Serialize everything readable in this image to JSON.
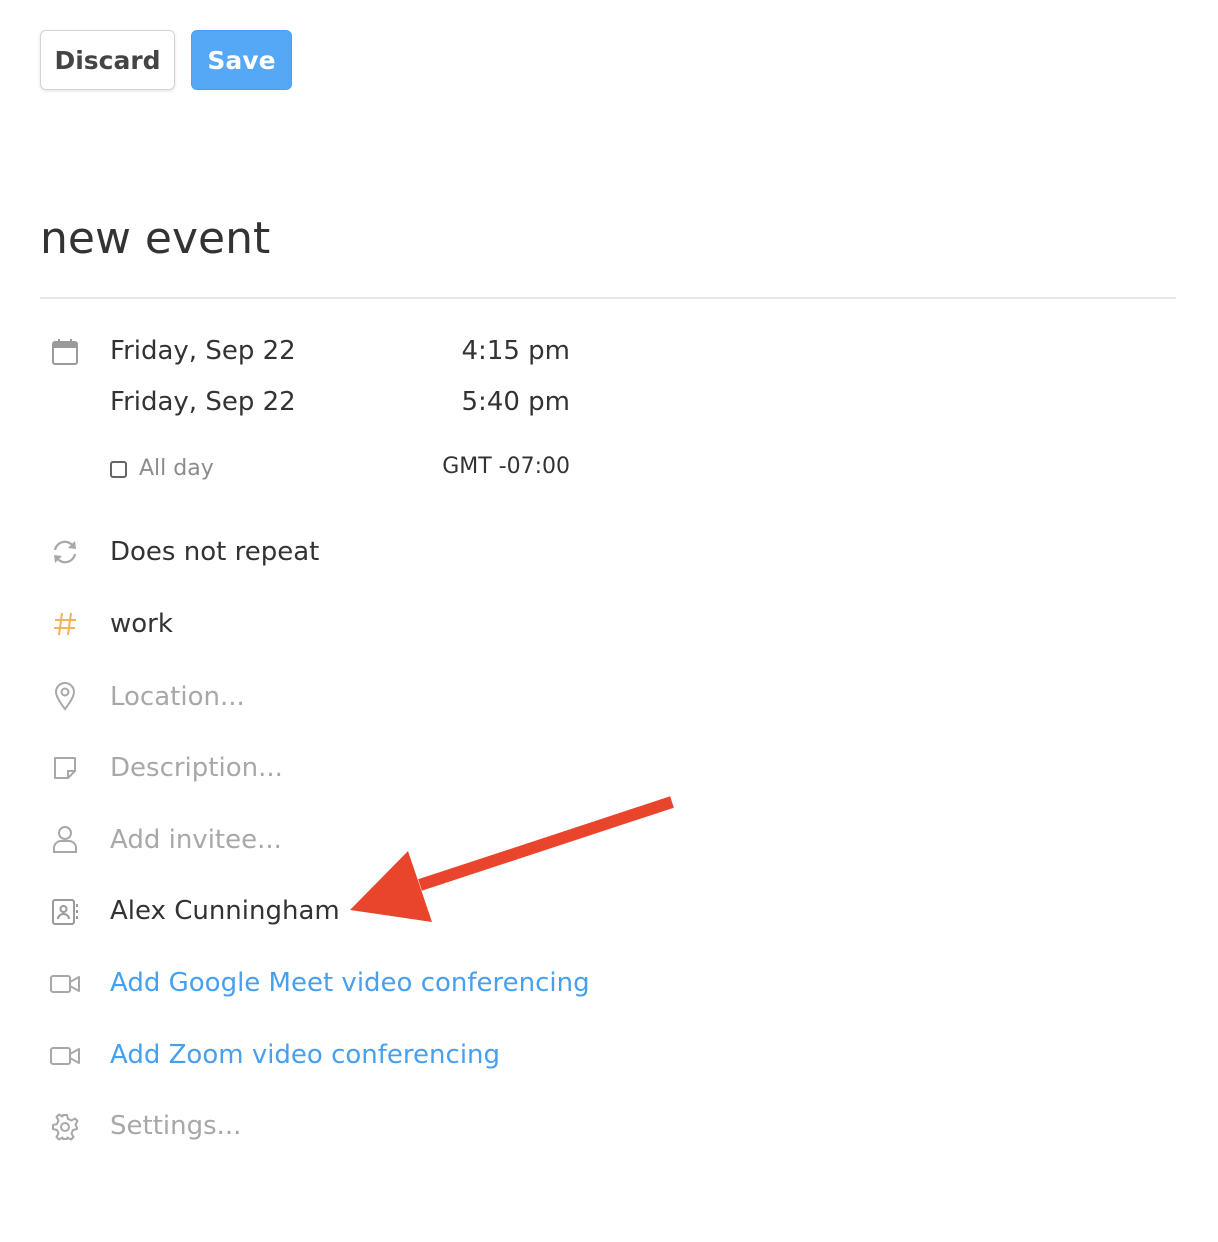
{
  "toolbar": {
    "discard_label": "Discard",
    "save_label": "Save"
  },
  "event": {
    "title": "new event",
    "start": {
      "date": "Friday, Sep 22",
      "time": "4:15 pm"
    },
    "end": {
      "date": "Friday, Sep 22",
      "time": "5:40 pm"
    },
    "all_day_label": "All day",
    "all_day_checked": false,
    "timezone": "GMT -07:00",
    "repeat": "Does not repeat",
    "tag": "work",
    "location_placeholder": "Location...",
    "description_placeholder": "Description...",
    "invitee_placeholder": "Add invitee...",
    "organizer": "Alex Cunningham",
    "google_meet_link": "Add Google Meet video conferencing",
    "zoom_link": "Add Zoom video conferencing",
    "settings_placeholder": "Settings..."
  },
  "icons": {
    "date": "calendar-icon",
    "repeat": "repeat-icon",
    "tag": "hashtag-icon",
    "location": "location-pin-icon",
    "description": "note-icon",
    "invitee": "person-icon",
    "organizer": "contact-card-icon",
    "google_meet": "video-camera-icon",
    "zoom": "video-camera-icon",
    "settings": "gear-icon"
  },
  "colors": {
    "save_button": "#55a8f6",
    "link": "#47a0ee",
    "tag_hash": "#f0b15a",
    "annotation_arrow": "#e8452c"
  },
  "annotation": {
    "type": "arrow",
    "points_to": "organizer"
  }
}
